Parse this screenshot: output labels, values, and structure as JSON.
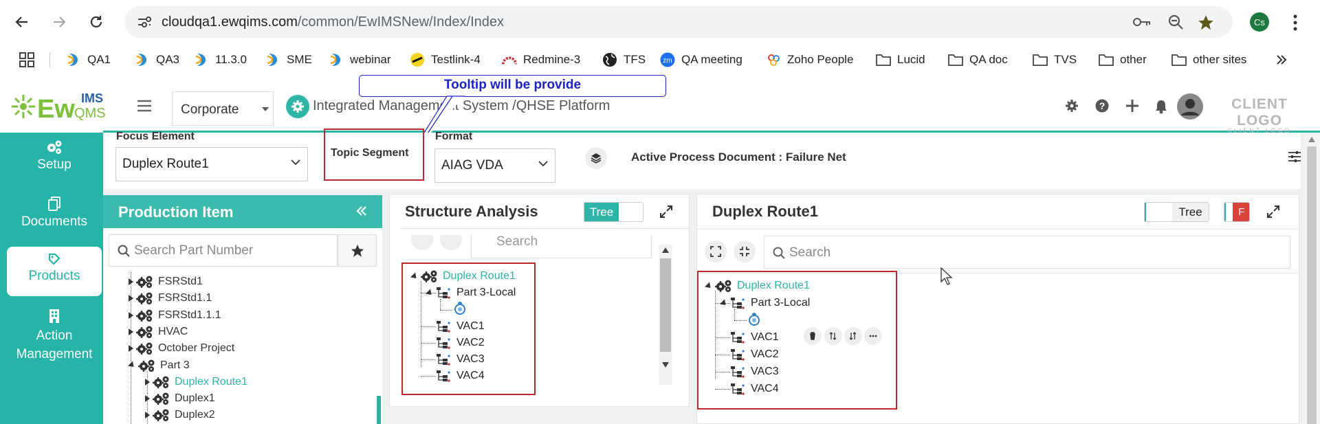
{
  "browser": {
    "url_host": "cloudqa1.ewqims.com",
    "url_path": "/common/EwIMSNew/Index/Index",
    "profile_initials": "Cs"
  },
  "bookmarks": [
    {
      "label": "QA1",
      "icon": "ewqims-icon"
    },
    {
      "label": "QA3",
      "icon": "ewqims-icon"
    },
    {
      "label": "11.3.0",
      "icon": "ewqims-icon"
    },
    {
      "label": "SME",
      "icon": "ewqims-icon"
    },
    {
      "label": "webinar",
      "icon": "ewqims-icon"
    },
    {
      "label": "Testlink-4",
      "icon": "testlink-icon"
    },
    {
      "label": "Redmine-3",
      "icon": "redmine-icon"
    },
    {
      "label": "TFS",
      "icon": "globe-icon"
    },
    {
      "label": "QA meeting",
      "icon": "zoom-icon"
    },
    {
      "label": "Zoho People",
      "icon": "zoho-icon"
    },
    {
      "label": "Lucid",
      "icon": "folder-icon"
    },
    {
      "label": "QA doc",
      "icon": "folder-icon"
    },
    {
      "label": "TVS",
      "icon": "folder-icon"
    },
    {
      "label": "other",
      "icon": "folder-icon"
    },
    {
      "label": "other sites",
      "icon": "folder-icon"
    }
  ],
  "header": {
    "logo_text": "EwQIMS",
    "corporate": "Corporate",
    "title": "Integrated Management System /QHSE Platform",
    "tooltip": "Tooltip will be provide",
    "client_logo": "CLIENT LOGO",
    "client_logo_sub": "CLIENT LOGO"
  },
  "sidebar": {
    "items": [
      {
        "label": "Setup",
        "icon": "gears-icon"
      },
      {
        "label": "Documents",
        "icon": "documents-icon"
      },
      {
        "label": "Products",
        "icon": "products-icon"
      },
      {
        "label": "Action Management",
        "icon": "building-icon"
      }
    ]
  },
  "filters": {
    "focus_label": "Focus Element",
    "focus_value": "Duplex Route1",
    "topic_label": "Topic Segment",
    "format_label": "Format",
    "format_value": "AIAG VDA",
    "active_doc": "Active Process Document : Failure Net"
  },
  "production": {
    "title": "Production Item",
    "search_placeholder": "Search Part Number",
    "tree": [
      {
        "label": "FSRStd1",
        "level": 0
      },
      {
        "label": "FSRStd1.1",
        "level": 0
      },
      {
        "label": "FSRStd1.1.1",
        "level": 0
      },
      {
        "label": "HVAC",
        "level": 0
      },
      {
        "label": "October Project",
        "level": 0
      },
      {
        "label": "Part 3",
        "level": 0
      },
      {
        "label": "Duplex Route1",
        "level": 1
      },
      {
        "label": "Duplex1",
        "level": 1
      },
      {
        "label": "Duplex2",
        "level": 1
      }
    ]
  },
  "structure": {
    "title": "Structure Analysis",
    "toggle_label": "Tree",
    "search_placeholder": "Search",
    "root": "Duplex Route1",
    "children": [
      "Part 3-Local",
      "VAC1",
      "VAC2",
      "VAC3",
      "VAC4"
    ]
  },
  "duplex": {
    "title": "Duplex Route1",
    "toggle_label": "Tree",
    "toggle2_label": "F",
    "search_placeholder": "Search",
    "root": "Duplex Route1",
    "children": [
      "Part 3-Local",
      "VAC1",
      "VAC2",
      "VAC3",
      "VAC4"
    ]
  },
  "colors": {
    "teal": "#26b3a8",
    "red_highlight": "#c0272d",
    "tooltip_blue": "#1a22c8"
  }
}
